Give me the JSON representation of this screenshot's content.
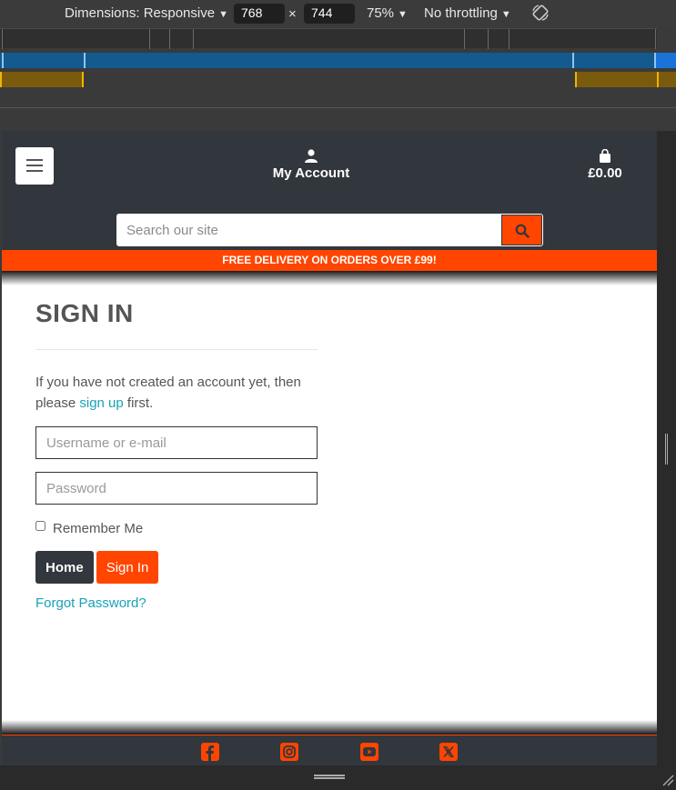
{
  "devtools": {
    "dimensions_label": "Dimensions: Responsive",
    "width": "768",
    "times": "×",
    "height": "744",
    "zoom": "75%",
    "throttling": "No throttling"
  },
  "header": {
    "account_label": "My Account",
    "bag_total": "£0.00",
    "search_placeholder": "Search our site"
  },
  "promo": "FREE DELIVERY ON ORDERS OVER £99!",
  "signin": {
    "title": "SIGN IN",
    "intro_before": "If you have not created an account yet, then please ",
    "intro_link": "sign up",
    "intro_after": " first.",
    "username_placeholder": "Username or e-mail",
    "password_placeholder": "Password",
    "remember_label": "Remember Me",
    "home_button": "Home",
    "signin_button": "Sign In",
    "forgot_link": "Forgot Password?"
  },
  "footer": {
    "social_icons": [
      "facebook-icon",
      "instagram-icon",
      "youtube-icon",
      "x-icon"
    ]
  },
  "colors": {
    "brand_dark": "#32363d",
    "accent": "#ff4500",
    "link": "#17a2b8"
  }
}
